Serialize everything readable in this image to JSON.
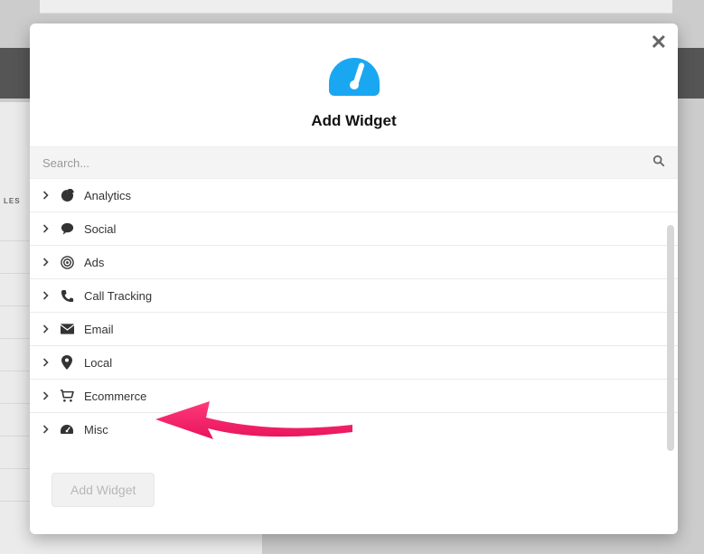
{
  "modal": {
    "title": "Add Widget",
    "close_glyph": "✕",
    "search": {
      "placeholder": "Search..."
    },
    "footer": {
      "add_button": "Add Widget"
    }
  },
  "categories": [
    {
      "id": "analytics",
      "label": "Analytics",
      "icon": "pie"
    },
    {
      "id": "social",
      "label": "Social",
      "icon": "comment"
    },
    {
      "id": "ads",
      "label": "Ads",
      "icon": "target"
    },
    {
      "id": "call-tracking",
      "label": "Call Tracking",
      "icon": "phone"
    },
    {
      "id": "email",
      "label": "Email",
      "icon": "envelope"
    },
    {
      "id": "local",
      "label": "Local",
      "icon": "pin"
    },
    {
      "id": "ecommerce",
      "label": "Ecommerce",
      "icon": "cart"
    },
    {
      "id": "misc",
      "label": "Misc",
      "icon": "dashboard"
    }
  ],
  "bg": {
    "les_label": "LES"
  }
}
